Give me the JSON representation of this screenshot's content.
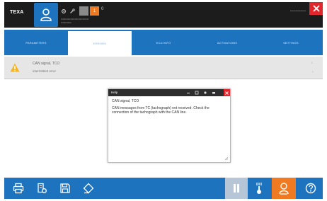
{
  "topbar": {
    "logo": "TEXA",
    "alert_badge": "1",
    "small_label": "0",
    "info_line1": "••••••••••••••••••••••••••••••••",
    "info_line2": "••••••••••••",
    "right_text": "••••••••••••••"
  },
  "tabs": [
    {
      "label": "PARAMETERS"
    },
    {
      "label": "ERRORS"
    },
    {
      "label": "ECU INFO"
    },
    {
      "label": "ACTIVATIONS"
    },
    {
      "label": "SETTINGS"
    }
  ],
  "active_tab": 1,
  "alert": {
    "title": "CAN signal, TCO",
    "subtitle": "intermittent error",
    "count": "1"
  },
  "help_dialog": {
    "title": "Help",
    "heading": "CAN signal, TCO",
    "body": "CAN messages from TC (tachograph) not received. Check the connection of the tachograph with the CAN line."
  },
  "colors": {
    "brand_blue": "#1e73be",
    "orange": "#f07a22",
    "red": "#e2262b",
    "dark": "#1c1c1c"
  },
  "icons": {
    "topbar": [
      "user-icon",
      "gear-icon",
      "wrench-icon",
      "close-icon"
    ],
    "bottombar": [
      "print-icon",
      "report-icon",
      "save-icon",
      "erase-icon",
      "pause-icon",
      "scan-icon",
      "technician-icon",
      "help-icon"
    ]
  }
}
